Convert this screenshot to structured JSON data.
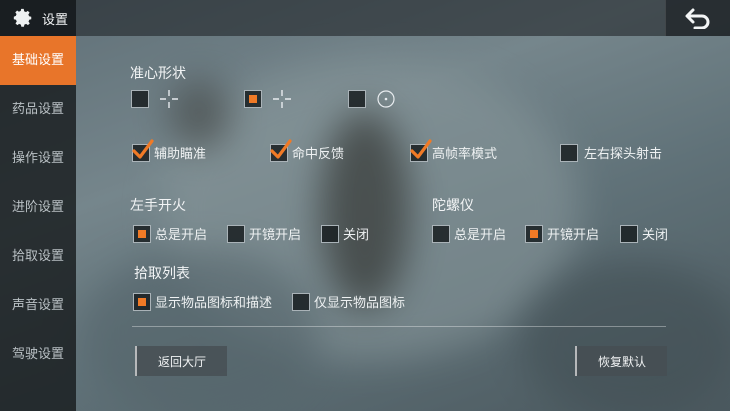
{
  "header": {
    "title": "设置",
    "icon": "gear-icon",
    "back_icon": "return-arrow-icon"
  },
  "sidebar": {
    "items": [
      {
        "label": "基础设置",
        "active": true
      },
      {
        "label": "药品设置",
        "active": false
      },
      {
        "label": "操作设置",
        "active": false
      },
      {
        "label": "进阶设置",
        "active": false
      },
      {
        "label": "拾取设置",
        "active": false
      },
      {
        "label": "声音设置",
        "active": false
      },
      {
        "label": "驾驶设置",
        "active": false
      }
    ]
  },
  "crosshair": {
    "title": "准心形状",
    "options": [
      {
        "shape": "cross-gap",
        "selected": false
      },
      {
        "shape": "cross-gap",
        "selected": true
      },
      {
        "shape": "circle-dot",
        "selected": false
      }
    ]
  },
  "toggles": [
    {
      "label": "辅助瞄准",
      "checked": true
    },
    {
      "label": "命中反馈",
      "checked": true
    },
    {
      "label": "高帧率模式",
      "checked": true
    },
    {
      "label": "左右探头射击",
      "checked": false
    }
  ],
  "left_fire": {
    "title": "左手开火",
    "options": [
      {
        "label": "总是开启",
        "selected": true
      },
      {
        "label": "开镜开启",
        "selected": false
      },
      {
        "label": "关闭",
        "selected": false
      }
    ]
  },
  "gyroscope": {
    "title": "陀螺仪",
    "options": [
      {
        "label": "总是开启",
        "selected": false
      },
      {
        "label": "开镜开启",
        "selected": true
      },
      {
        "label": "关闭",
        "selected": false
      }
    ]
  },
  "pickup_list": {
    "title": "拾取列表",
    "options": [
      {
        "label": "显示物品图标和描述",
        "selected": true
      },
      {
        "label": "仅显示物品图标",
        "selected": false
      }
    ]
  },
  "footer": {
    "back_lobby": "返回大厅",
    "reset_default": "恢复默认"
  },
  "colors": {
    "accent": "#e8752a",
    "check": "#f07a26"
  }
}
